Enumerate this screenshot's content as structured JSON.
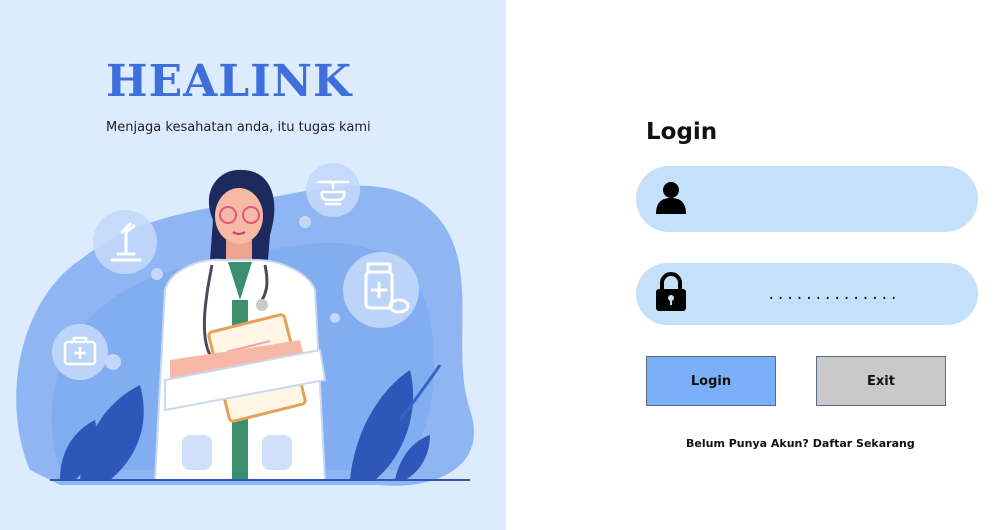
{
  "brand": {
    "name": "HEALINK",
    "tagline": "Menjaga kesahatan anda, itu tugas kami"
  },
  "login": {
    "title": "Login",
    "username": {
      "value": "",
      "icon": "user-icon"
    },
    "password": {
      "value": "..............",
      "icon": "lock-icon"
    },
    "login_button": "Login",
    "exit_button": "Exit",
    "register_prompt": "Belum Punya Akun?",
    "register_link": "Daftar Sekarang"
  },
  "colors": {
    "left_panel": "#dcebfd",
    "brand": "#3f6fd8",
    "field": "#c5e0fa",
    "login_button": "#7ab0f7",
    "exit_button": "#c9c9c9"
  }
}
